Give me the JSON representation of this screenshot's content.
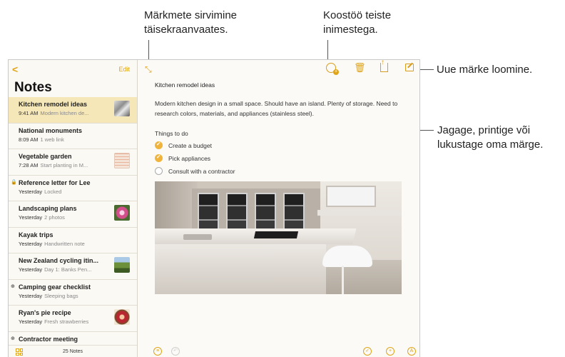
{
  "callouts": {
    "fullscreen": "Märkmete sirvimine\ntäisekraanvaates.",
    "collaborate": "Koostöö teiste\ninimestega.",
    "new_note": "Uue märke loomine.",
    "share": "Jagage, printige või\nlukustage oma märge."
  },
  "sidebar": {
    "back_glyph": "<",
    "edit_label": "Edit",
    "title": "Notes",
    "notes": [
      {
        "title": "Kitchen remodel ideas",
        "date": "9:41 AM",
        "preview": "Modern kitchen de...",
        "thumb": "kitchen"
      },
      {
        "title": "National monuments",
        "date": "8:09 AM",
        "preview": "1 web link"
      },
      {
        "title": "Vegetable garden",
        "date": "7:28 AM",
        "preview": "Start planting in M...",
        "thumb": "garden"
      },
      {
        "title": "Reference letter for Lee",
        "date": "Yesterday",
        "preview": "Locked",
        "marker": "lock-icon"
      },
      {
        "title": "Landscaping plans",
        "date": "Yesterday",
        "preview": "2 photos",
        "thumb": "flower"
      },
      {
        "title": "Kayak trips",
        "date": "Yesterday",
        "preview": "Handwritten note"
      },
      {
        "title": "New Zealand cycling itin...",
        "date": "Yesterday",
        "preview": "Day 1: Banks Pen...",
        "thumb": "nz"
      },
      {
        "title": "Camping gear checklist",
        "date": "Yesterday",
        "preview": "Sleeping bags",
        "marker": "shared-icon"
      },
      {
        "title": "Ryan's pie recipe",
        "date": "Yesterday",
        "preview": "Fresh strawberries",
        "thumb": "pie"
      },
      {
        "title": "Contractor meeting",
        "date": "",
        "preview": "",
        "marker": "shared-icon"
      }
    ],
    "count_label": "25 Notes"
  },
  "editor": {
    "title": "Kitchen remodel ideas",
    "body": "Modern kitchen design in a small space. Should have an island. Plenty of storage. Need to research colors, materials, and appliances (stainless steel).",
    "todo_heading": "Things to do",
    "todos": [
      {
        "label": "Create a budget",
        "done": true
      },
      {
        "label": "Pick appliances",
        "done": true
      },
      {
        "label": "Consult with a contractor",
        "done": false
      }
    ]
  },
  "icons": {
    "toolbar": [
      "fullscreen-icon",
      "collaborate-icon",
      "trash-icon",
      "share-icon",
      "compose-icon"
    ],
    "bottom": [
      "checklist-icon",
      "undo-icon",
      "check-circle-icon",
      "add-icon",
      "markup-icon"
    ]
  },
  "colors": {
    "accent": "#e0a418",
    "selected_row": "#f6e7b8"
  }
}
